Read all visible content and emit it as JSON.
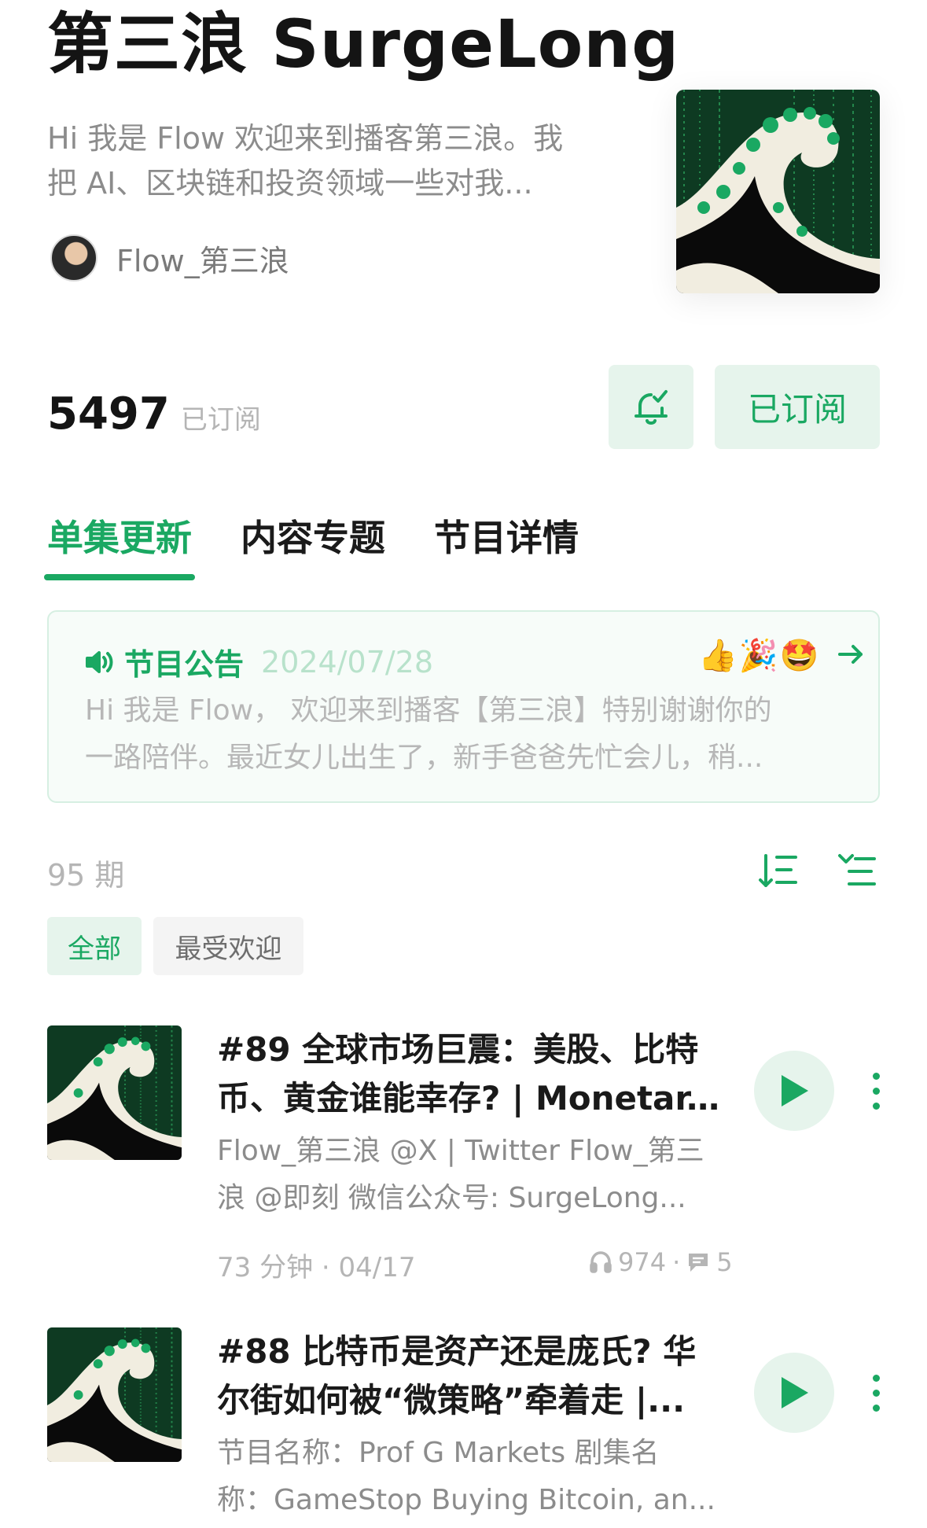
{
  "podcast": {
    "title": "第三浪 SurgeLong",
    "description_line1": "Hi 我是 Flow 欢迎来到播客第三浪。我",
    "description_line2": "把 AI、区块链和投资领域一些对我...",
    "author": "Flow_第三浪",
    "subscriber_count": "5497",
    "subscriber_label": "已订阅",
    "subscribe_button": "已订阅"
  },
  "tabs": [
    {
      "label": "单集更新",
      "active": true
    },
    {
      "label": "内容专题",
      "active": false
    },
    {
      "label": "节目详情",
      "active": false
    }
  ],
  "notice": {
    "title": "节目公告",
    "date": "2024/07/28",
    "emojis": "👍🎉🤩",
    "line1": "Hi 我是 Flow， 欢迎来到播客【第三浪】特别谢谢你的",
    "line2": "一路陪伴。最近女儿出生了，新手爸爸先忙会儿，稍..."
  },
  "episodes_header": {
    "count": "95 期",
    "filters": [
      "全部",
      "最受欢迎"
    ]
  },
  "episodes": [
    {
      "title_line1": "#89 全球市场巨震：美股、比特",
      "title_line2": "币、黄金谁能幸存? | Monetar...",
      "desc_line1": "Flow_第三浪 @X | Twitter Flow_第三",
      "desc_line2": "浪 @即刻 微信公众号: SurgeLong...",
      "duration_date": "73 分钟 · 04/17",
      "plays": "974",
      "comments": "5"
    },
    {
      "title_line1": "#88 比特币是资产还是庞氏? 华",
      "title_line2": "尔街如何被“微策略”牵着走 |...",
      "desc_line1": "节目名称：Prof G Markets 剧集名",
      "desc_line2": "称：GameStop Buying Bitcoin, an..."
    }
  ],
  "colors": {
    "accent": "#1aa862",
    "accent_bg": "#e6f4ec",
    "muted_text": "#8c8c8c",
    "light_text": "#b5b5b5"
  },
  "icons": [
    "bell-check-icon",
    "speaker-icon",
    "arrow-right-icon",
    "sort-desc-icon",
    "list-filter-icon",
    "headphones-icon",
    "comment-icon",
    "play-icon",
    "more-vertical-icon"
  ]
}
